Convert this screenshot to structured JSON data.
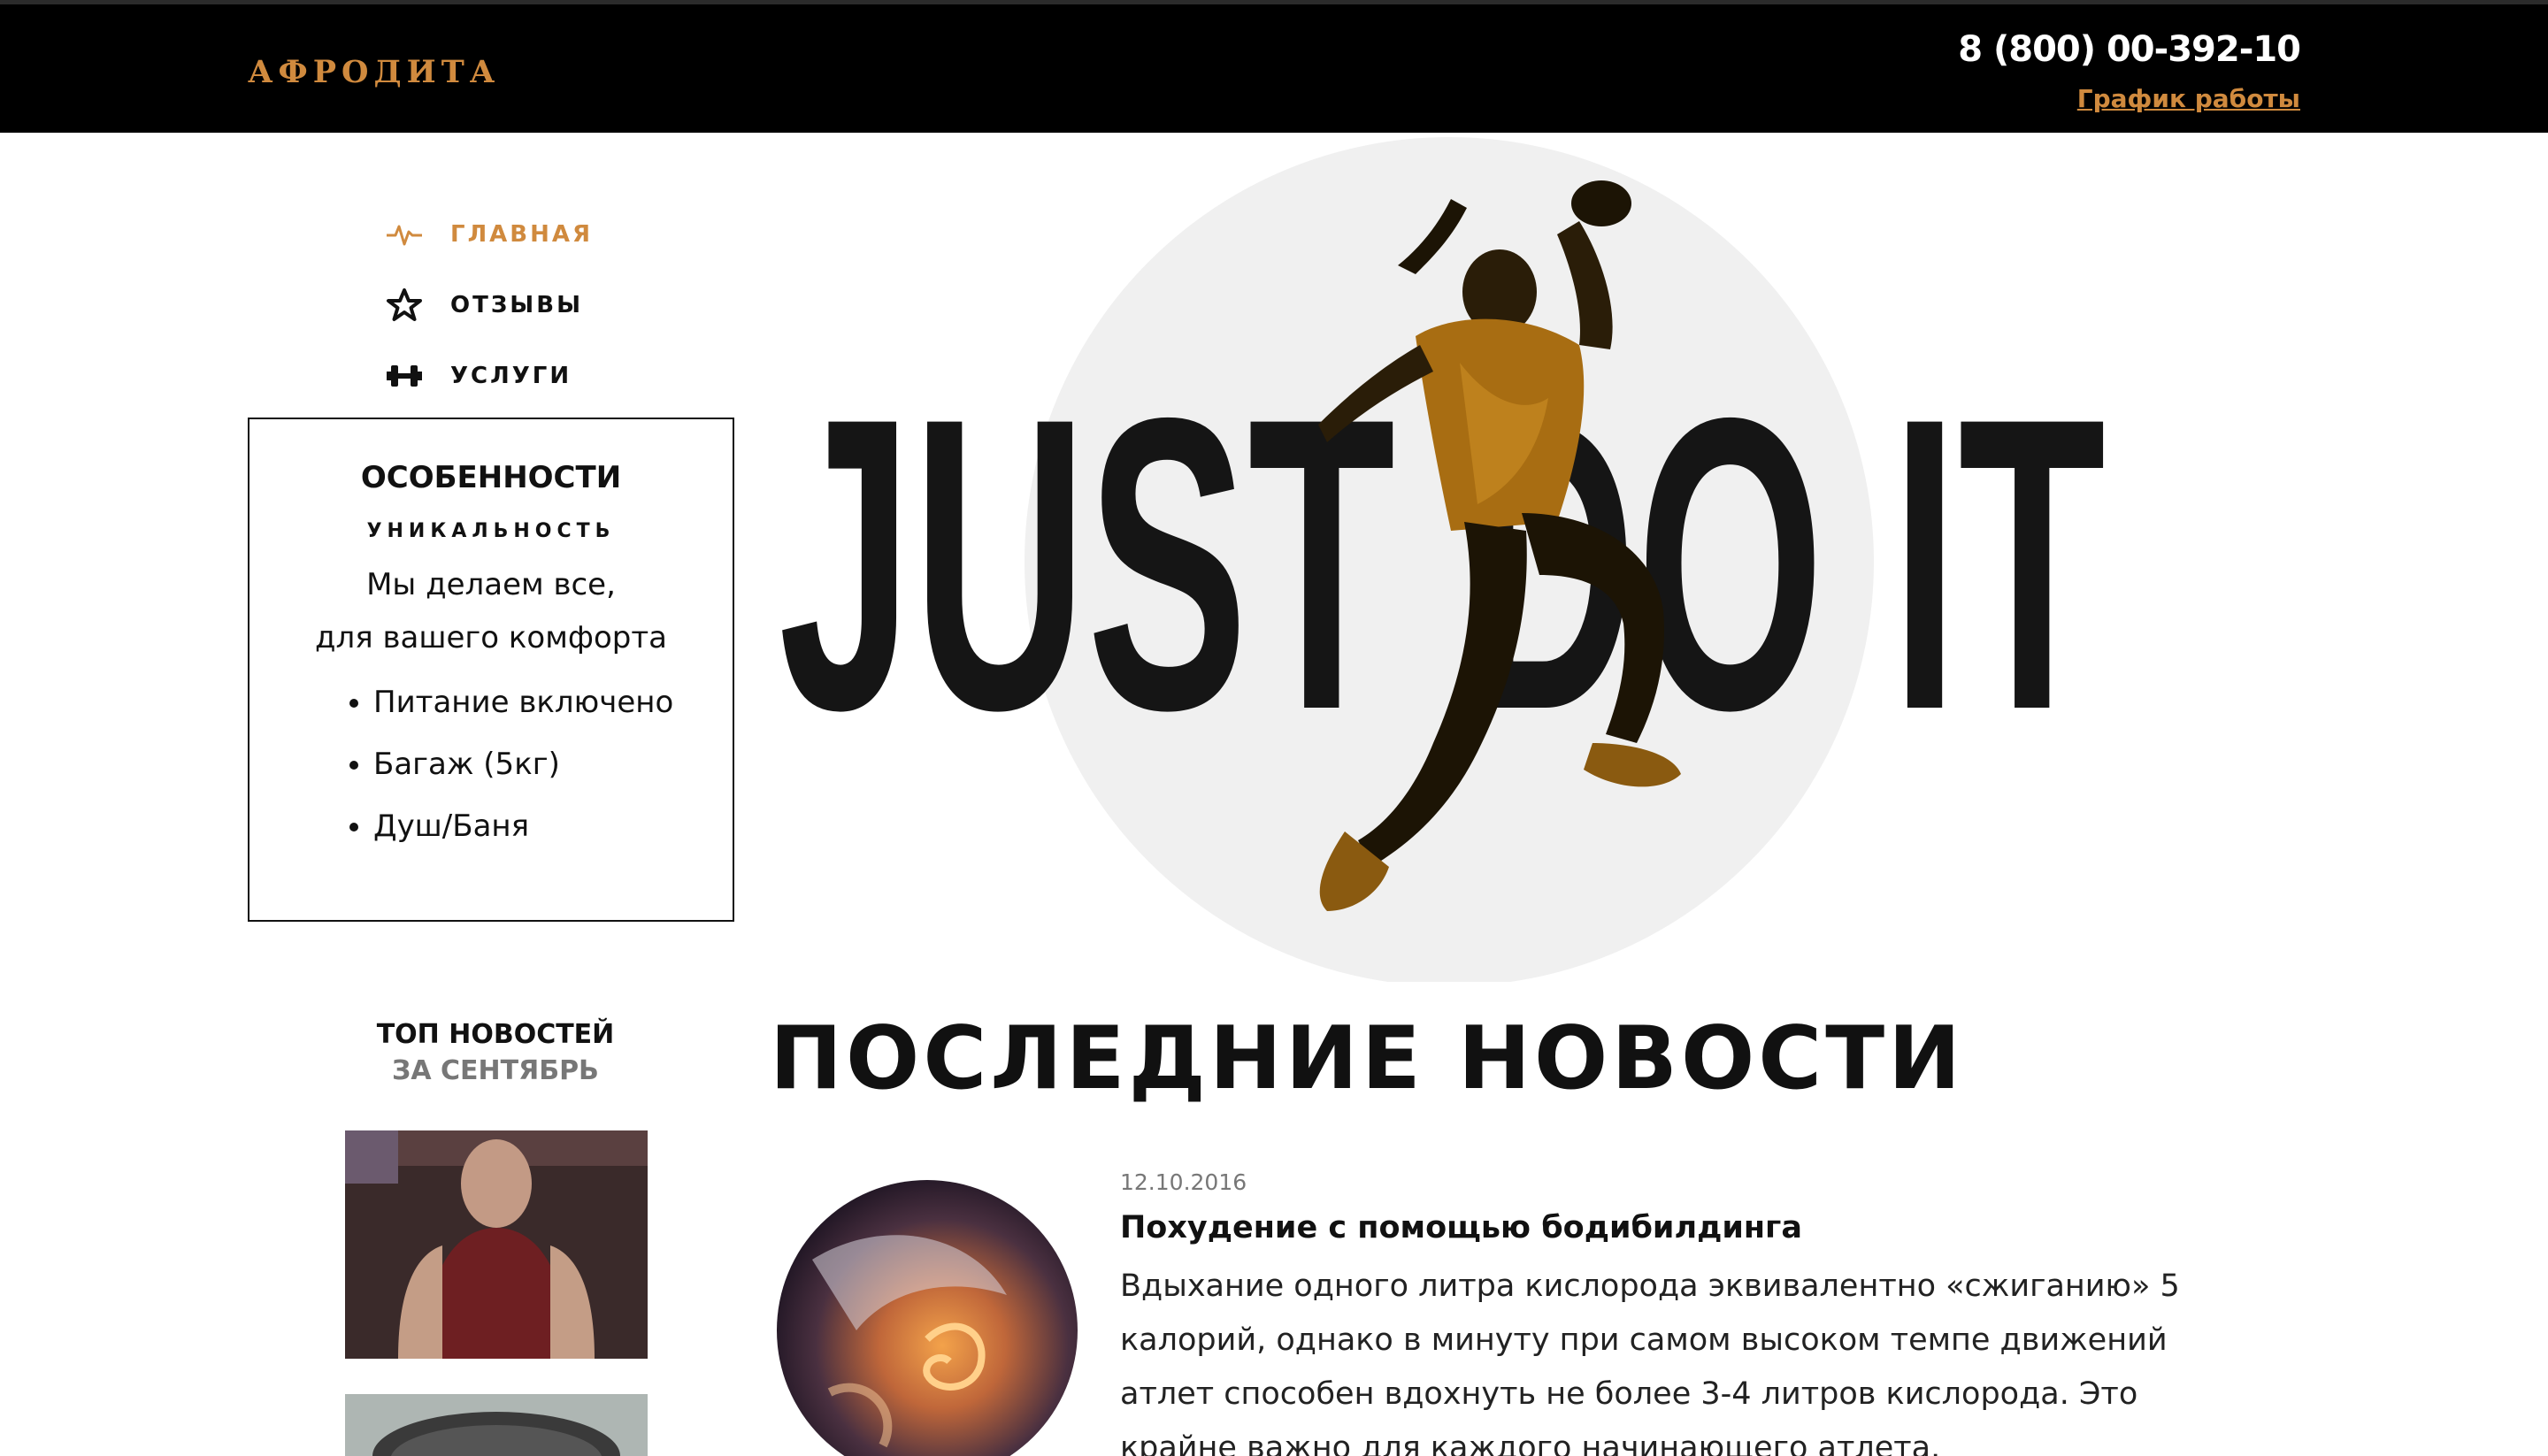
{
  "header": {
    "logo": "АФРОДИТА",
    "phone": "8 (800) 00-392-10",
    "schedule_link": "График работы"
  },
  "nav": {
    "items": [
      {
        "label": "ГЛАВНАЯ",
        "icon": "pulse-icon",
        "active": true
      },
      {
        "label": "ОТЗЫВЫ",
        "icon": "star-icon",
        "active": false
      },
      {
        "label": "УСЛУГИ",
        "icon": "dumbbell-icon",
        "active": false
      }
    ]
  },
  "features": {
    "title": "ОСОБЕННОСТИ",
    "subtitle": "УНИКАЛЬНОСТЬ",
    "desc_line1": "Мы делаем все,",
    "desc_line2": "для вашего комфорта",
    "items": [
      "Питание включено",
      "Багаж (5кг)",
      "Душ/Баня"
    ]
  },
  "hero": {
    "text": "JUST DO IT"
  },
  "top_news": {
    "title": "ТОП НОВОСТЕЙ",
    "period": "ЗА СЕНТЯБРЬ"
  },
  "latest": {
    "title": "ПОСЛЕДНИЕ НОВОСТИ",
    "article": {
      "date": "12.10.2016",
      "headline": "Похудение с помощью бодибилдинга",
      "text": "Вдыхание одного литра кислорода эквивалентно «сжиганию» 5 калорий, однако в минуту при самом высоком темпе движений атлет способен вдохнуть не более 3-4 литров кислорода. Это крайне важно для каждого начинающего атлета."
    }
  },
  "colors": {
    "accent": "#d08a3e",
    "header_bg": "#000000"
  }
}
